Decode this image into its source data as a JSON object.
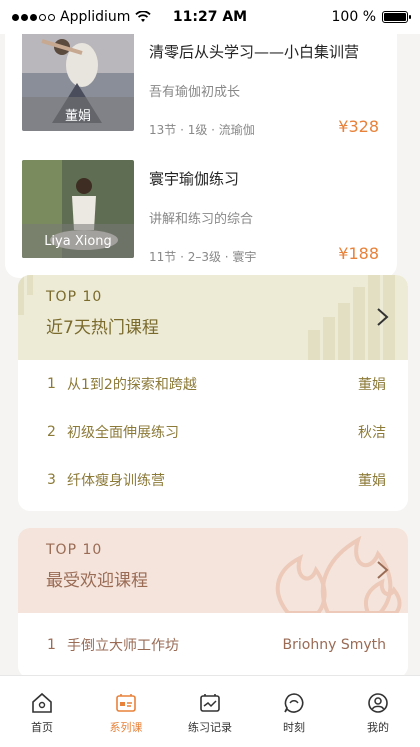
{
  "status_bar": {
    "carrier": "Applidium",
    "time": "11:27 AM",
    "battery": "100 %"
  },
  "courses": [
    {
      "title": "清零后从头学习——小白集训营",
      "subtitle": "吾有瑜伽初成长",
      "meta": "13节 · 1级 · 流瑜伽",
      "price": "¥328",
      "teacher": "董娟"
    },
    {
      "title": "寰宇瑜伽练习",
      "subtitle": "讲解和练习的综合",
      "meta": "11节 · 2–3级 · 寰宇",
      "price": "¥188",
      "teacher": "Liya Xiong"
    }
  ],
  "rank_hot": {
    "eyebrow": "TOP  10",
    "title": "近7天热门课程",
    "items": [
      {
        "rank": "1",
        "name": "从1到2的探索和跨越",
        "teacher": "董娟"
      },
      {
        "rank": "2",
        "name": "初级全面伸展练习",
        "teacher": "秋洁"
      },
      {
        "rank": "3",
        "name": "纤体瘦身训练营",
        "teacher": "董娟"
      }
    ]
  },
  "rank_popular": {
    "eyebrow": "TOP  10",
    "title": "最受欢迎课程",
    "items": [
      {
        "rank": "1",
        "name": "手倒立大师工作坊",
        "teacher": "Briohny Smyth"
      }
    ]
  },
  "tabbar": [
    {
      "label": "首页",
      "icon": "home-icon"
    },
    {
      "label": "系列课",
      "icon": "series-icon",
      "active": true
    },
    {
      "label": "练习记录",
      "icon": "record-icon"
    },
    {
      "label": "时刻",
      "icon": "moments-icon"
    },
    {
      "label": "我的",
      "icon": "profile-icon"
    }
  ],
  "colors": {
    "accent": "#e8823a",
    "hot_bg": "#edebd6",
    "popular_bg": "#f4e4db"
  }
}
